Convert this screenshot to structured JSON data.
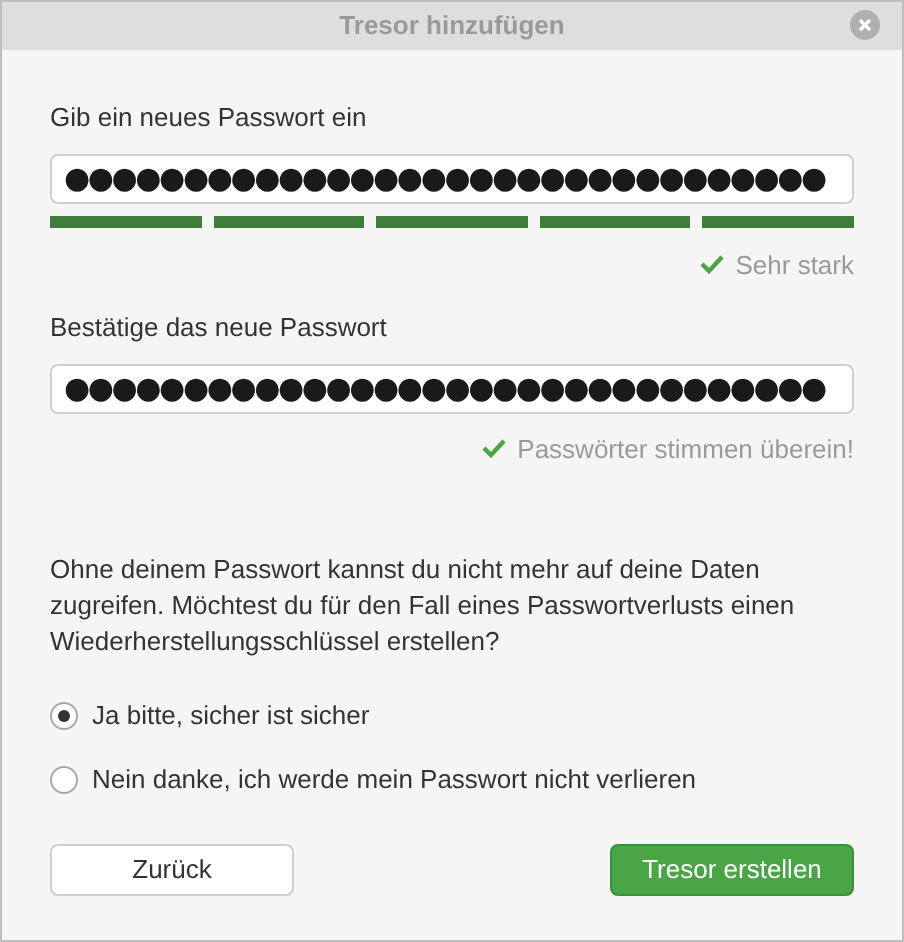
{
  "window": {
    "title": "Tresor hinzufügen"
  },
  "new_password": {
    "label": "Gib ein neues Passwort ein",
    "value": "●●●●●●●●●●●●●●●●●●●●●●●●●●●●●●●●",
    "strength": {
      "level": 1,
      "text": "Sehr stark"
    }
  },
  "confirm_password": {
    "label": "Bestätige das neue Passwort",
    "value": "●●●●●●●●●●●●●●●●●●●●●●●●●●●●●●●●",
    "match": {
      "ok": true,
      "text": "Passwörter stimmen überein!"
    }
  },
  "recovery": {
    "text": "Ohne deinem Passwort kannst du nicht mehr auf deine Daten zugreifen. Möchtest du für den Fall eines Passwortverlusts einen Wiederherstellungsschlüssel erstellen?",
    "options": [
      {
        "label": "Ja bitte, sicher ist sicher",
        "selected": true
      },
      {
        "label": "Nein danke, ich werde mein Passwort nicht verlieren",
        "selected": false
      }
    ]
  },
  "buttons": {
    "back": "Zurück",
    "create": "Tresor erstellen"
  }
}
